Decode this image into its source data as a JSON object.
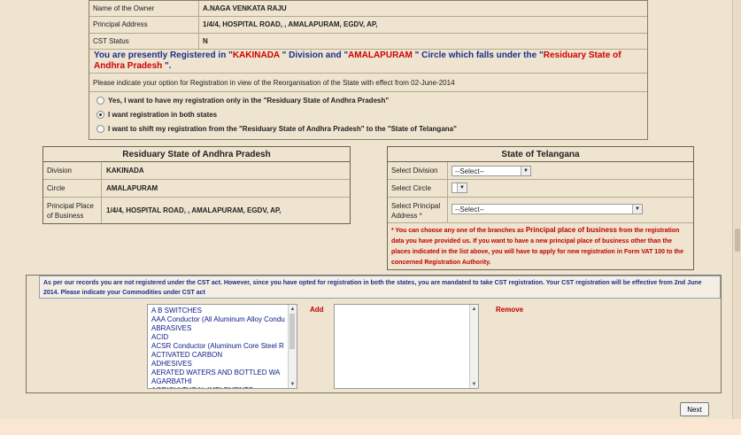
{
  "owner_info": {
    "owner_label": "Name of the Owner",
    "owner_value": "A.NAGA VENKATA RAJU",
    "address_label": "Principal Address",
    "address_value": "1/4/4, HOSPITAL ROAD, , AMALAPURAM, EGDV, AP,",
    "cst_label": "CST Status",
    "cst_value": "N"
  },
  "notice": {
    "part1": "You are presently Registered in \"",
    "division": "KAKINADA",
    "part2": " \" Division and \"",
    "circle": "AMALAPURAM",
    "part3": " \" Circle which falls under the \"",
    "state": "Residuary State of Andhra Pradesh",
    "part4": " \"."
  },
  "prompt": "Please indicate your option for Registration in view of the Reorganisation of the State with effect from 02-June-2014",
  "options": [
    {
      "label": "Yes, I want to have my registration only in the \"Residuary State of Andhra Pradesh\"",
      "selected": false
    },
    {
      "label": "I want registration in both states",
      "selected": true
    },
    {
      "label": "I want to shift my registration from the \"Residuary State of Andhra Pradesh\" to the \"State of Telangana\"",
      "selected": false
    }
  ],
  "ap_table": {
    "title": "Residuary State of Andhra Pradesh",
    "division_label": "Division",
    "division_value": "KAKINADA",
    "circle_label": "Circle",
    "circle_value": "AMALAPURAM",
    "place_label": "Principal Place of Business",
    "place_value": "1/4/4, HOSPITAL ROAD, , AMALAPURAM, EGDV, AP,"
  },
  "tg_table": {
    "title": "State of Telangana",
    "division_label": "Select Division",
    "division_value": "--Select--",
    "circle_label": "Select Circle",
    "circle_value": "",
    "address_label": "Select Principal Address",
    "address_required": "*",
    "address_value": "--Select--",
    "note_part1": "* You can choose any one of the branches as ",
    "note_bold": "Principal place of business",
    "note_part2": " from the registration data you have provided us. If you want to have a new principal place of business other than the places indicated in the list above, you will have to apply for new registration in Form VAT 100 to the concerned Registration Authority."
  },
  "cst": {
    "message": "As per our records you are not registered under the CST act. However, since you have opted for registration in both the states, you are mandated to take CST registration. Your CST registration will be effective from 2nd June 2014. Please indicate your Commodities under CST act",
    "commodities": [
      "A B SWITCHES",
      "AAA Conductor (All Aluminum Alloy Condu",
      "ABRASIVES",
      "ACID",
      "ACSR Conductor (Aluminum Core Steel R",
      "ACTIVATED CARBON",
      "ADHESIVES",
      "AERATED WATERS AND BOTTLED WA",
      "AGARBATHI",
      "AGRICULTURAL IMPLEMENTS"
    ],
    "add_label": "Add",
    "remove_label": "Remove"
  },
  "next_label": "Next"
}
